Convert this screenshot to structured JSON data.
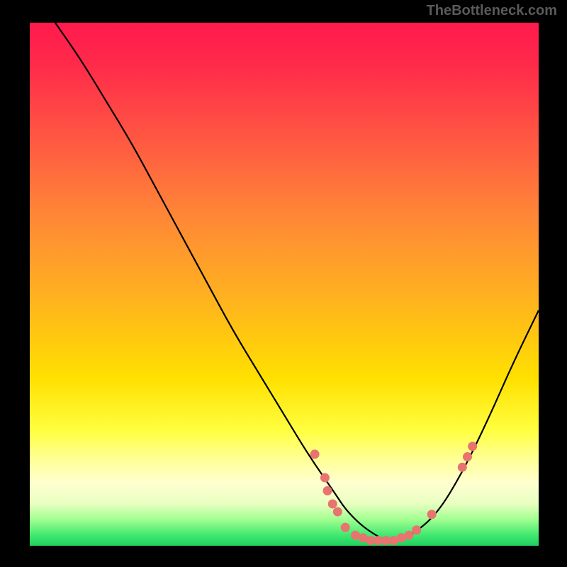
{
  "watermark": "TheBottleneck.com",
  "chart_data": {
    "type": "line",
    "title": "",
    "xlabel": "",
    "ylabel": "",
    "xlim": [
      0,
      100
    ],
    "ylim": [
      0,
      100
    ],
    "curve": {
      "name": "bottleneck-curve",
      "x": [
        5,
        10,
        15,
        20,
        25,
        30,
        35,
        40,
        45,
        50,
        55,
        60,
        62,
        65,
        68,
        70,
        72,
        75,
        80,
        85,
        90,
        95,
        100
      ],
      "y": [
        100,
        93,
        85,
        77,
        68,
        59,
        50,
        41,
        33,
        25,
        17,
        10,
        7,
        4,
        2,
        1,
        1,
        2,
        6,
        14,
        24,
        35,
        45
      ]
    },
    "points": {
      "name": "data-points",
      "color": "#e8736f",
      "data": [
        {
          "x": 56,
          "y": 17.5
        },
        {
          "x": 58,
          "y": 13
        },
        {
          "x": 58.5,
          "y": 10.5
        },
        {
          "x": 59.5,
          "y": 8
        },
        {
          "x": 60.5,
          "y": 6.5
        },
        {
          "x": 62,
          "y": 3.5
        },
        {
          "x": 64,
          "y": 2
        },
        {
          "x": 65.5,
          "y": 1.5
        },
        {
          "x": 67,
          "y": 1
        },
        {
          "x": 68.5,
          "y": 1
        },
        {
          "x": 70,
          "y": 1
        },
        {
          "x": 71.5,
          "y": 1
        },
        {
          "x": 73,
          "y": 1.5
        },
        {
          "x": 74.5,
          "y": 2
        },
        {
          "x": 76,
          "y": 3
        },
        {
          "x": 79,
          "y": 6
        },
        {
          "x": 85,
          "y": 15
        },
        {
          "x": 86,
          "y": 17
        },
        {
          "x": 87,
          "y": 19
        }
      ]
    }
  }
}
